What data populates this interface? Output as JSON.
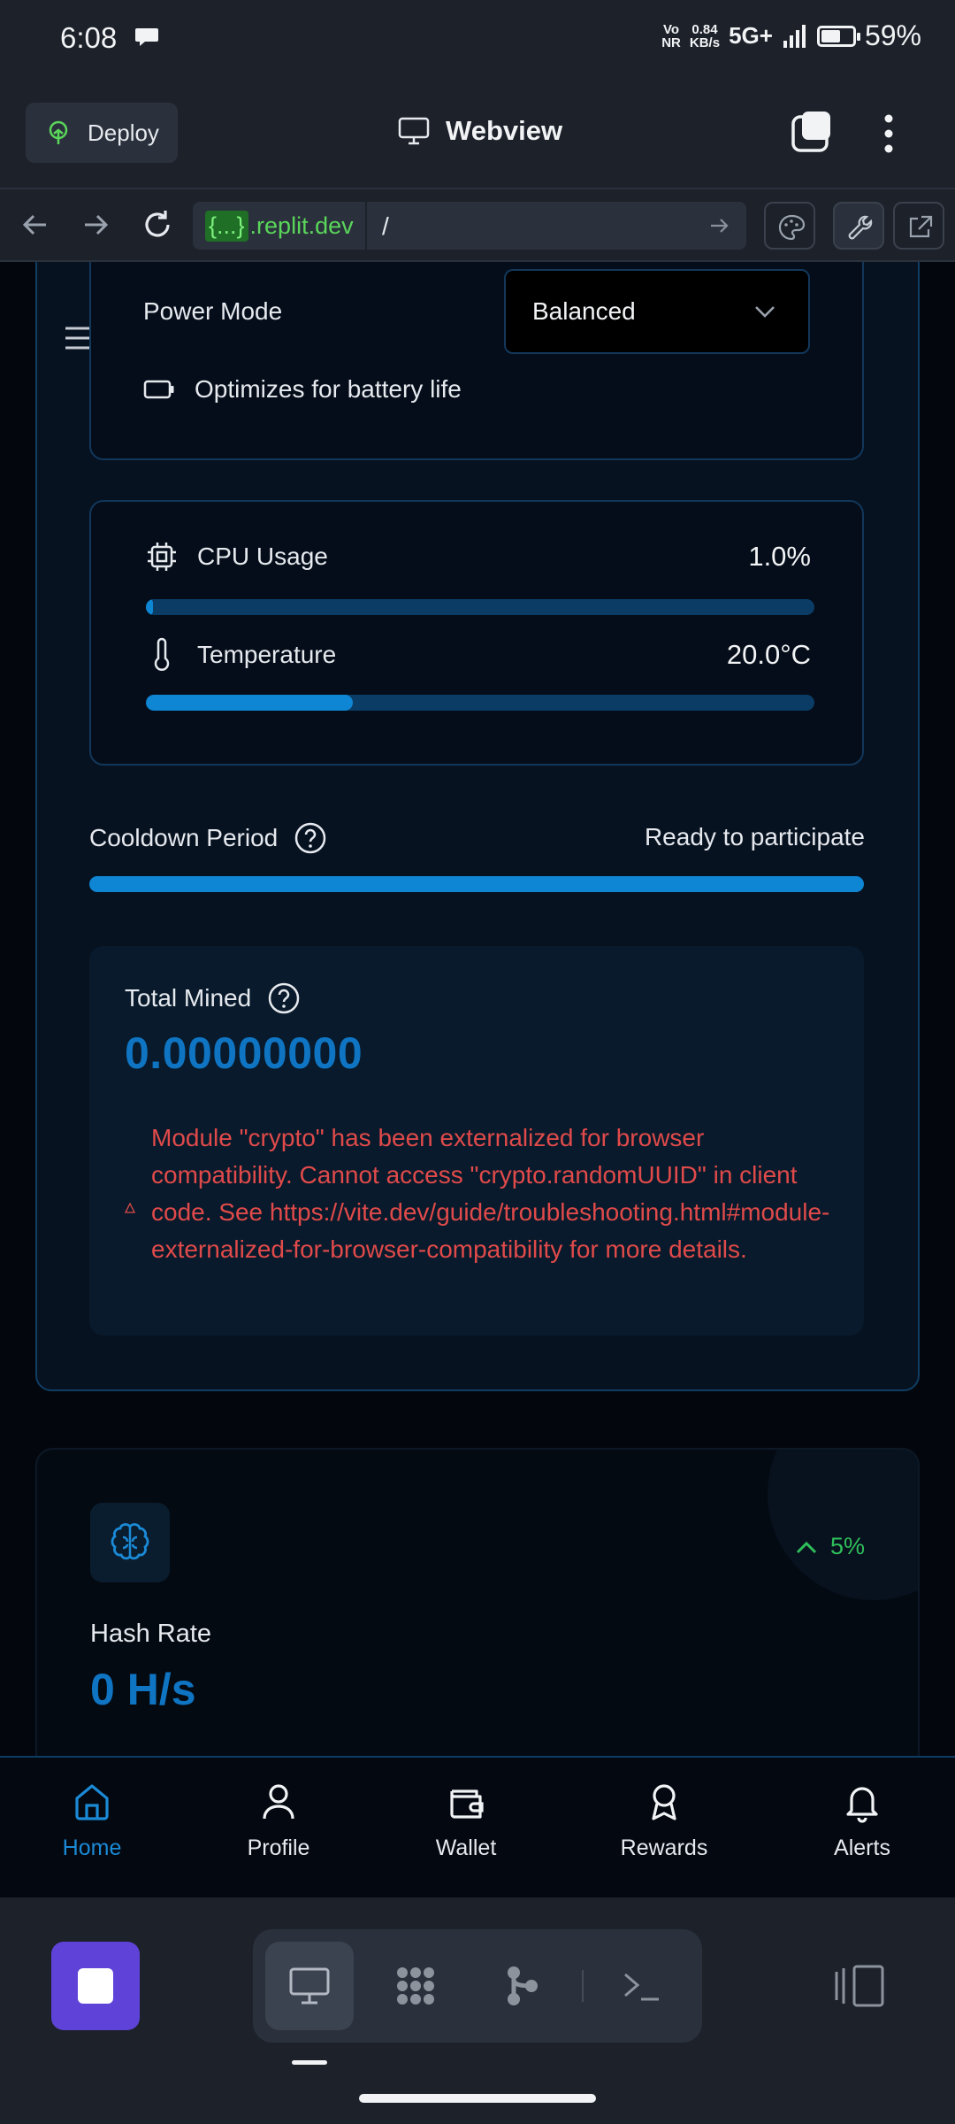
{
  "status_bar": {
    "time": "6:08",
    "net_top": "Vo",
    "net_bottom": "NR",
    "speed_value": "0.84",
    "speed_unit": "KB/s",
    "network": "5G+",
    "battery": "59%",
    "battery_level": 0.59
  },
  "replit_header": {
    "deploy_label": "Deploy",
    "title": "Webview"
  },
  "url_bar": {
    "domain_brace": "{...}",
    "domain": ".replit.dev",
    "path": "/"
  },
  "power": {
    "label": "Power Mode",
    "selected": "Balanced",
    "hint": "Optimizes for battery life"
  },
  "stats": {
    "cpu_label": "CPU Usage",
    "cpu_value": "1.0%",
    "cpu_fraction": 0.01,
    "temp_label": "Temperature",
    "temp_value": "20.0°C",
    "temp_fraction": 0.31
  },
  "cooldown": {
    "label": "Cooldown Period",
    "status": "Ready to participate",
    "fraction": 1.0
  },
  "mined": {
    "label": "Total Mined",
    "value": "0.00000000",
    "error": "Module \"crypto\" has been externalized for browser compatibility. Cannot access \"crypto.randomUUID\" in client code. See https://vite.dev/guide/troubleshooting.html#module-externalized-for-browser-compatibility for more details."
  },
  "hash": {
    "trend": "5%",
    "label": "Hash Rate",
    "value": "0 H/s"
  },
  "nav": {
    "items": [
      {
        "label": "Home",
        "icon": "home-icon",
        "active": true
      },
      {
        "label": "Profile",
        "icon": "user-icon",
        "active": false
      },
      {
        "label": "Wallet",
        "icon": "wallet-icon",
        "active": false
      },
      {
        "label": "Rewards",
        "icon": "award-icon",
        "active": false
      },
      {
        "label": "Alerts",
        "icon": "bell-icon",
        "active": false
      }
    ]
  },
  "colors": {
    "accent": "#0e86d4",
    "error": "#e04a4a",
    "trend_up": "#2fbf5a",
    "stop_button": "#5f43d8"
  }
}
